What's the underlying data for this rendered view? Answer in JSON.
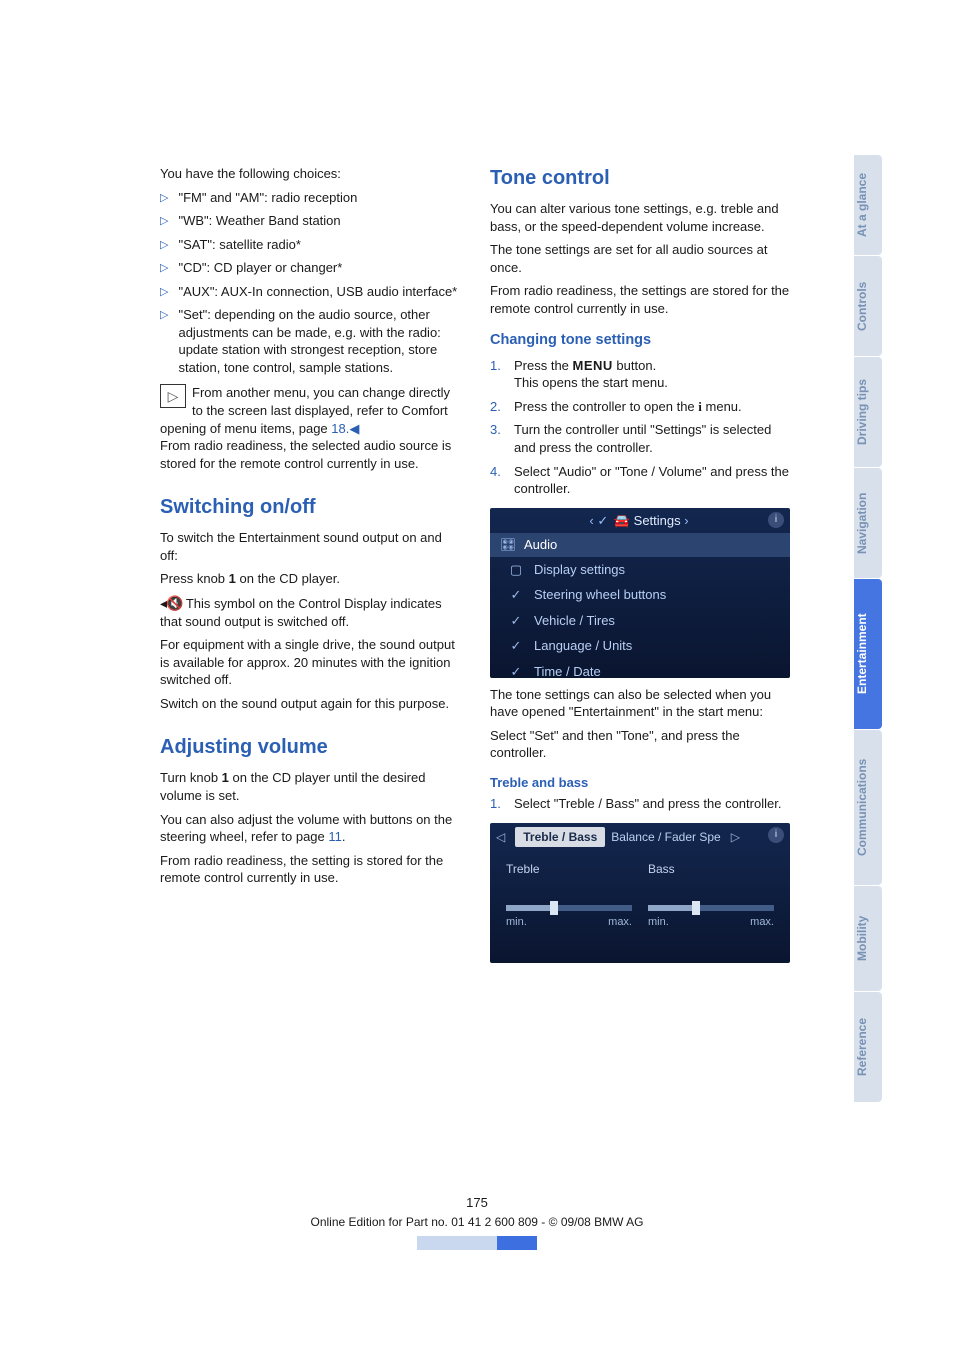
{
  "left": {
    "intro": "You have the following choices:",
    "choices": [
      "\"FM\" and \"AM\": radio reception",
      "\"WB\": Weather Band station",
      "\"SAT\": satellite radio*",
      "\"CD\": CD player or changer*",
      "\"AUX\": AUX-In connection, USB audio interface*",
      "\"Set\": depending on the audio source, other adjustments can be made, e.g. with the radio: update station with strongest reception, store station, tone control, sample stations."
    ],
    "note_pre": "From another menu, you can change directly to the screen last displayed, refer to Comfort opening of menu items, page ",
    "note_link": "18",
    "note_post": ".◀",
    "after_note": "From radio readiness, the selected audio source is stored for the remote control currently in use.",
    "switch_h": "Switching on/off",
    "switch_p1": "To switch the Entertainment sound output on and off:",
    "switch_p2_pre": "Press knob ",
    "switch_p2_bold": "1",
    "switch_p2_post": " on the CD player.",
    "mute_sym": "◀🔇",
    "switch_p3": " This symbol on the Control Display indicates that sound output is switched off.",
    "switch_p4": "For equipment with a single drive, the sound output is available for approx. 20 minutes with the ignition switched off.",
    "switch_p5": "Switch on the sound output again for this purpose.",
    "vol_h": "Adjusting volume",
    "vol_p1_pre": "Turn knob ",
    "vol_p1_bold": "1",
    "vol_p1_post": " on the CD player until the desired volume is set.",
    "vol_p2_pre": "You can also adjust the volume with buttons on the steering wheel, refer to page ",
    "vol_p2_link": "11",
    "vol_p2_post": ".",
    "vol_p3": "From radio readiness, the setting is stored for the remote control currently in use."
  },
  "right": {
    "h": "Tone control",
    "p1": "You can alter various tone settings, e.g. treble and bass, or the speed-dependent volume increase.",
    "p2": "The tone settings are set for all audio sources at once.",
    "p3": "From radio readiness, the settings are stored for the remote control currently in use.",
    "cts_h": "Changing tone settings",
    "steps": [
      {
        "n": "1.",
        "text_pre": "Press the ",
        "menu": "MENU",
        "text_post": " button.",
        "text2": "This opens the start menu."
      },
      {
        "n": "2.",
        "text_pre": "Press the controller to open the ",
        "isym": "i",
        "text_post": " menu."
      },
      {
        "n": "3.",
        "text": "Turn the controller until \"Settings\" is selected and press the controller."
      },
      {
        "n": "4.",
        "text": "Select \"Audio\" or \"Tone / Volume\" and press the controller."
      }
    ],
    "screen_settings": {
      "title_pre": "‹ ✓",
      "title": "Settings",
      "title_post": " ›",
      "audio": "Audio",
      "rows": [
        "Display settings",
        "Steering wheel buttons",
        "Vehicle / Tires",
        "Language / Units",
        "Time / Date"
      ]
    },
    "after_screen1": "The tone settings can also be selected when you have opened \"Entertainment\" in the start menu:",
    "after_screen2": "Select \"Set\" and then \"Tone\", and press the controller.",
    "tb_h": "Treble and bass",
    "tb_step_n": "1.",
    "tb_step": "Select \"Treble / Bass\" and press the controller.",
    "screen_tb": {
      "tab_active": "Treble / Bass",
      "tab_other": "Balance / Fader  Spe",
      "treble": "Treble",
      "bass": "Bass",
      "min": "min.",
      "max": "max."
    }
  },
  "tabs": [
    "At a glance",
    "Controls",
    "Driving tips",
    "Navigation",
    "Entertainment",
    "Communications",
    "Mobility",
    "Reference"
  ],
  "footer": {
    "page": "175",
    "line": "Online Edition for Part no. 01 41 2 600 809 - © 09/08 BMW AG"
  }
}
